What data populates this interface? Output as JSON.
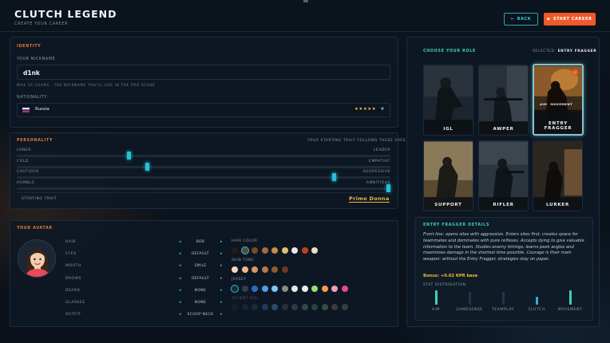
{
  "header": {
    "title": "CLUTCH LEGEND",
    "subtitle": "CREATE YOUR CAREER",
    "back_label": "BACK",
    "start_label": "START CAREER"
  },
  "identity": {
    "section_title": "IDENTITY",
    "nickname_label": "YOUR NICKNAME",
    "nickname_value": "d1nk",
    "nickname_hint": "MAX 16 CHARS · THE NICKNAME YOU'LL USE IN THE PRO SCENE",
    "nationality_label": "NATIONALITY",
    "nationality_value": "Russia",
    "nationality_stars": "★★★★★"
  },
  "personality": {
    "section_title": "PERSONALITY",
    "hint": "YOUR STARTING TRAIT FOLLOWS THESE AXES",
    "traits": [
      {
        "left": "LONER",
        "right": "LEADER",
        "value": 0.3
      },
      {
        "left": "COLD",
        "right": "EMPATHIC",
        "value": 0.35
      },
      {
        "left": "CAUTIOUS",
        "right": "AGGRESSIVE",
        "value": 0.85
      },
      {
        "left": "HUMBLE",
        "right": "AMBITIOUS",
        "value": 1.0
      }
    ],
    "starting_trait_label": "STARTING TRAIT",
    "starting_trait_value": "Primo Donna"
  },
  "avatar": {
    "section_title": "YOUR AVATAR",
    "options": [
      {
        "key": "HAIR",
        "value": "BOB"
      },
      {
        "key": "EYES",
        "value": "DEFAULT"
      },
      {
        "key": "MOUTH",
        "value": "SMILE"
      },
      {
        "key": "BROWS",
        "value": "DEFAULT"
      },
      {
        "key": "BEARD",
        "value": "NONE"
      },
      {
        "key": "GLASSES",
        "value": "NONE"
      },
      {
        "key": "OUTFIT",
        "value": "SCOOP NECK"
      }
    ],
    "hair_color_label": "HAIR COLOR",
    "hair_colors": [
      "#2a1a14",
      "#5a4a3c",
      "#7a4a2a",
      "#a86a3a",
      "#c98a4a",
      "#e0c06a",
      "#e8e8e8",
      "#c0401e",
      "#f2dcc0"
    ],
    "hair_selected": 1,
    "skin_tone_label": "SKIN TONE",
    "skin_tones": [
      "#f6d6bf",
      "#eab892",
      "#d6966a",
      "#b8784a",
      "#945a34",
      "#6a3a22"
    ],
    "skin_selected": -1,
    "jersey_label": "JERSEY",
    "jersey_colors": [
      "#1c2a38",
      "#2e3e50",
      "#2a6cc0",
      "#4aa0e8",
      "#7ec8f0",
      "#8a8a8a",
      "#e8e8e8",
      "#f0f0f0",
      "#9adf7a",
      "#f0a04a",
      "#f0a0b8",
      "#e84a8a"
    ],
    "jersey_selected": 0,
    "accent_label": "ACCENT COL",
    "accent_colors": [
      "#1a2430",
      "#243040",
      "#203a5a",
      "#2c5a8a",
      "#3a7ab0",
      "#3a4654",
      "#4a5664",
      "#5a6674",
      "#3c6a4a",
      "#5a7a5a",
      "#6a5a4a",
      "#5a5a5a"
    ]
  },
  "roles": {
    "section_title": "CHOOSE YOUR ROLE",
    "selected_label": "SELECTED:",
    "selected_value": "ENTRY FRAGGER",
    "cards": [
      {
        "name": "IGL"
      },
      {
        "name": "AWPER"
      },
      {
        "name": "ENTRY FRAGGER",
        "tags": [
          "AIM",
          "MOVEMENT"
        ]
      },
      {
        "name": "SUPPORT"
      },
      {
        "name": "RIFLER"
      },
      {
        "name": "LURKER"
      }
    ]
  },
  "details": {
    "section_title": "ENTRY FRAGGER DETAILS",
    "description": "Front line: opens sites with aggression. Enters sites first, creates space for teammates and dominates with pure reflexes. Accepts dying to give valuable information to the team. Studies enemy timings, learns peek angles and maximises damage in the shortest time possible. Courage is their main weapon: without the Entry Fragger, strategies stay on paper.",
    "bonus": "Bonus: +0.02 KPR base",
    "stat_title": "STAT DISTRIBUTION",
    "stats": [
      {
        "name": "AIM",
        "value": 1.0,
        "color": "#3fd0b8"
      },
      {
        "name": "GAMESENSE",
        "value": 0.9,
        "color": "#22364a"
      },
      {
        "name": "TEAMPLAY",
        "value": 0.9,
        "color": "#22364a"
      },
      {
        "name": "CLUTCH",
        "value": 0.55,
        "color": "#3aa8e0"
      },
      {
        "name": "MOVEMENT",
        "value": 1.0,
        "color": "#3fd0b8"
      }
    ]
  }
}
